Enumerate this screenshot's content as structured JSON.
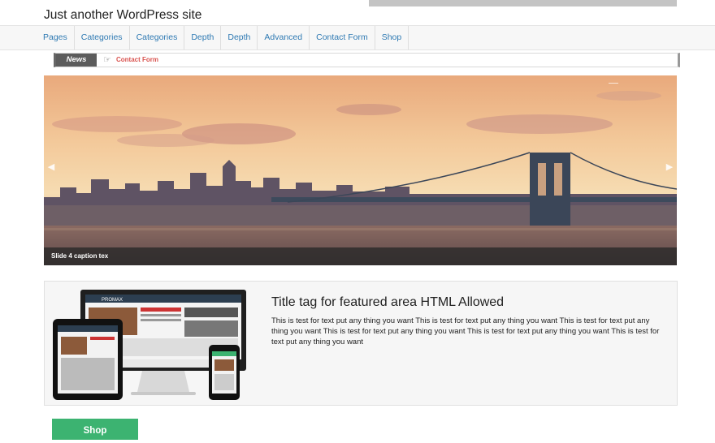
{
  "site": {
    "title": "Just another WordPress site"
  },
  "nav": {
    "items": [
      {
        "label": "Pages"
      },
      {
        "label": "Categories"
      },
      {
        "label": "Categories"
      },
      {
        "label": "Depth"
      },
      {
        "label": "Depth"
      },
      {
        "label": "Advanced"
      },
      {
        "label": "Contact Form"
      },
      {
        "label": "Shop"
      }
    ]
  },
  "ticker": {
    "label": "News",
    "icon": "pointing-hand-icon",
    "link": "Contact Form"
  },
  "slider": {
    "caption": "Slide 4 caption tex",
    "prev_icon": "arrow-left-icon",
    "next_icon": "arrow-right-icon"
  },
  "featured": {
    "title": "Title tag for featured area HTML Allowed",
    "text": "This is test for text put any thing you want This is test for text put any thing you want This is test for text put any thing you want This is test for text put any thing you want This is test for text put any thing you want This is test for text put any thing you want",
    "devices_logo": "PROMAX"
  },
  "shop_button": {
    "label": "Shop"
  },
  "colors": {
    "link": "#2f7ab3",
    "ticker_link": "#d9534f",
    "shop_button": "#3cb371"
  }
}
